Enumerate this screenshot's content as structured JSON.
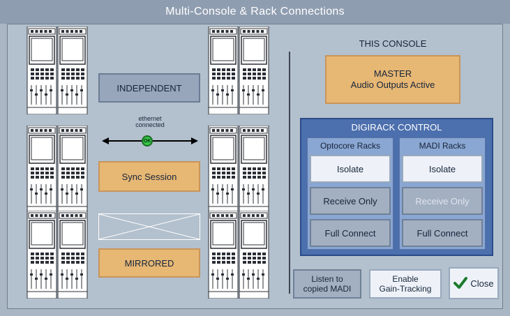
{
  "window": {
    "title": "Multi-Console & Rack Connections"
  },
  "modes": {
    "independent": "INDEPENDENT",
    "sync_session": "Sync Session",
    "mirrored": "MIRRORED"
  },
  "ethernet": {
    "line1": "ethernet",
    "line2": "connected",
    "ok_badge": "OK"
  },
  "this_console": {
    "heading": "THIS CONSOLE",
    "role_line1": "MASTER",
    "role_line2": "Audio Outputs Active"
  },
  "digirack": {
    "title": "DIGIRACK CONTROL",
    "optocore": {
      "title": "Optocore Racks",
      "isolate": "Isolate",
      "receive_only": "Receive Only",
      "full_connect": "Full Connect"
    },
    "madi": {
      "title": "MADI Racks",
      "isolate": "Isolate",
      "receive_only": "Receive Only",
      "full_connect": "Full Connect"
    }
  },
  "bottom": {
    "listen_line1": "Listen to",
    "listen_line2": "copied MADI",
    "gain_line1": "Enable",
    "gain_line2": "Gain-Tracking",
    "close": "Close"
  },
  "colors": {
    "accent_orange": "#e7b774",
    "panel_blue": "#4c6fad",
    "ok_green": "#35c445"
  },
  "icons": {
    "console": "console-icon",
    "close": "checkmark-icon",
    "link": "double-arrow-icon"
  }
}
